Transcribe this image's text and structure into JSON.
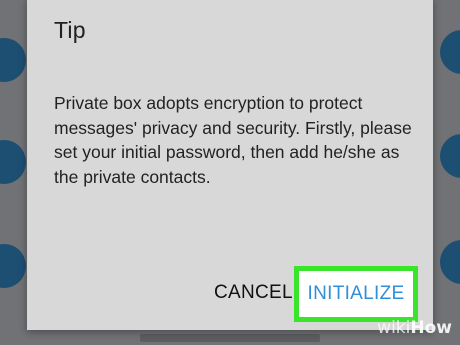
{
  "dialog": {
    "title": "Tip",
    "body": "Private box adopts encryption to protect messages' privacy and security. Firstly, please set your initial password, then add he/she as the private contacts.",
    "cancel_label": "CANCEL",
    "initialize_label": "INITIALIZE"
  },
  "watermark": {
    "prefix": "wiki",
    "suffix": "How"
  },
  "colors": {
    "highlight": "#39e52b",
    "initialize_text": "#2f8fd8",
    "dialog_bg": "#d8d8d8",
    "avatar": "#1d4f73"
  }
}
